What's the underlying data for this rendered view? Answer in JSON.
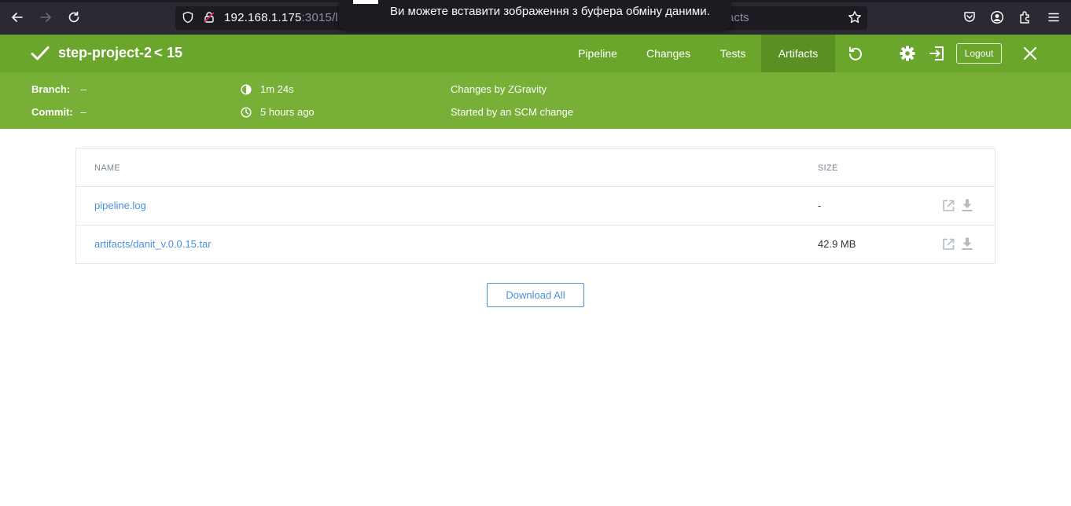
{
  "browser": {
    "url_host": "192.168.1.175",
    "url_rest": ":3015/l",
    "url_tail": "acts",
    "toast_message": "Ви можете вставити зображення з буфера обміну даними."
  },
  "header": {
    "project": "step-project-2",
    "separator": "<",
    "run_number": "15",
    "tabs": [
      {
        "label": "Pipeline",
        "active": false
      },
      {
        "label": "Changes",
        "active": false
      },
      {
        "label": "Tests",
        "active": false
      },
      {
        "label": "Artifacts",
        "active": true
      }
    ],
    "logout_label": "Logout",
    "colors": {
      "primary": "#6aa62c",
      "active_tab": "#5a8f24",
      "sub_bar": "#78b037"
    }
  },
  "run_info": {
    "branch_label": "Branch:",
    "branch_value": "–",
    "commit_label": "Commit:",
    "commit_value": "–",
    "duration": "1m 24s",
    "time_ago": "5 hours ago",
    "changes_by": "Changes by ZGravity",
    "started_by": "Started by an SCM change"
  },
  "artifacts": {
    "columns": {
      "name": "NAME",
      "size": "SIZE"
    },
    "rows": [
      {
        "name": "pipeline.log",
        "size": "-"
      },
      {
        "name": "artifacts/danit_v.0.0.15.tar",
        "size": "42.9 MB"
      }
    ],
    "download_all_label": "Download All",
    "link_color": "#4a90e2"
  },
  "icons": [
    "back-arrow-icon",
    "forward-arrow-icon",
    "reload-icon",
    "shield-icon",
    "insecure-lock-icon",
    "bookmark-star-icon",
    "pocket-icon",
    "account-icon",
    "extensions-icon",
    "menu-icon",
    "success-check-icon",
    "rerun-icon",
    "gear-icon",
    "exit-classic-icon",
    "close-icon",
    "duration-icon",
    "clock-icon",
    "open-external-icon",
    "download-icon"
  ]
}
